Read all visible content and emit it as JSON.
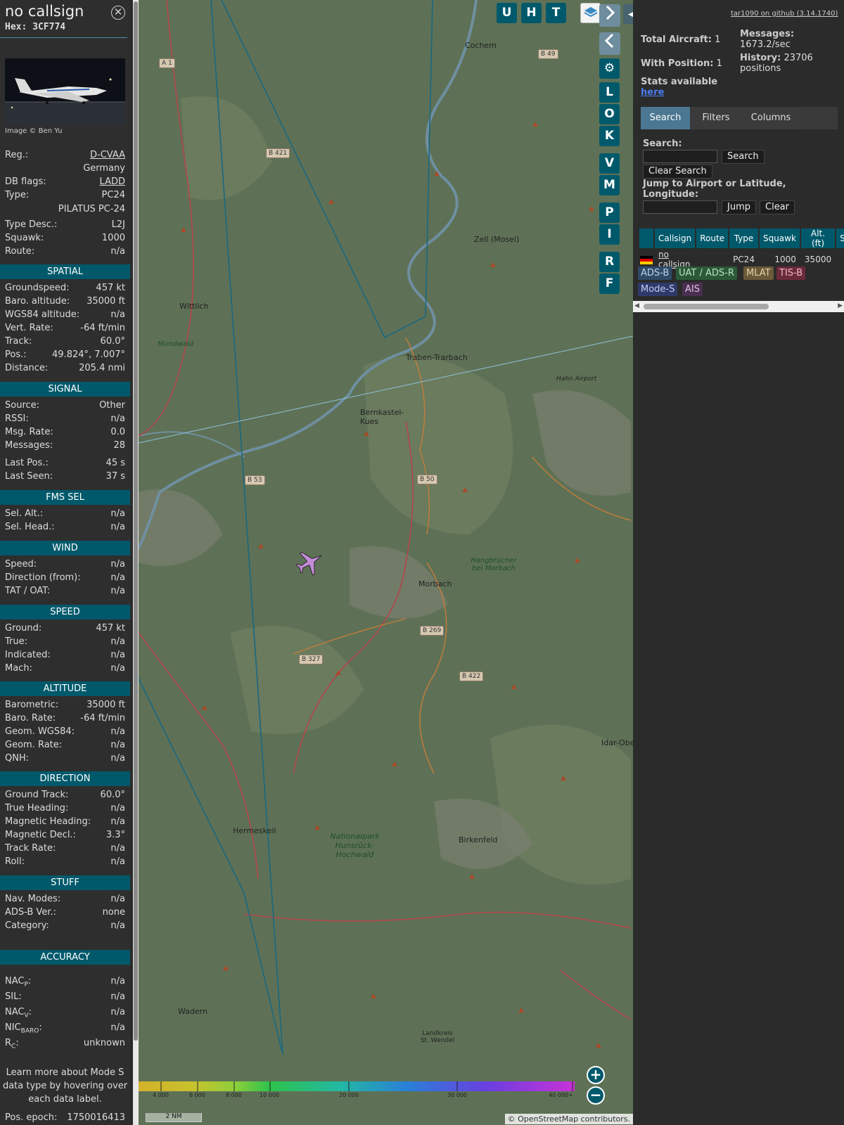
{
  "info": {
    "callsign": "no callsign",
    "hex": "Hex: 3CF774",
    "image_credit": "Image © Ben Yu",
    "reg": {
      "label": "Reg.:",
      "value": "D-CVAA",
      "country": "Germany"
    },
    "dbflags": {
      "label": "DB flags:",
      "value": "LADD"
    },
    "type": {
      "label": "Type:",
      "value": "PC24",
      "desc_full": "PILATUS PC-24"
    },
    "type_desc": {
      "label": "Type Desc.:",
      "value": "L2J"
    },
    "squawk": {
      "label": "Squawk:",
      "value": "1000"
    },
    "route": {
      "label": "Route:",
      "value": "n/a"
    },
    "sections": {
      "spatial": "SPATIAL",
      "signal": "SIGNAL",
      "fms": "FMS SEL",
      "wind": "WIND",
      "speed": "SPEED",
      "altitude": "ALTITUDE",
      "direction": "DIRECTION",
      "stuff": "STUFF",
      "accuracy": "ACCURACY"
    },
    "spatial": [
      {
        "k": "Groundspeed:",
        "v": "457 kt"
      },
      {
        "k": "Baro. altitude:",
        "v": "35000 ft"
      },
      {
        "k": "WGS84 altitude:",
        "v": "n/a"
      },
      {
        "k": "Vert. Rate:",
        "v": "-64 ft/min"
      },
      {
        "k": "Track:",
        "v": "60.0°"
      },
      {
        "k": "Pos.:",
        "v": "49.824°, 7.007°"
      },
      {
        "k": "Distance:",
        "v": "205.4 nmi"
      }
    ],
    "signal": [
      {
        "k": "Source:",
        "v": "Other"
      },
      {
        "k": "RSSI:",
        "v": "n/a"
      },
      {
        "k": "Msg. Rate:",
        "v": "0.0"
      },
      {
        "k": "Messages:",
        "v": "28"
      },
      {
        "k": "Last Pos.:",
        "v": "45 s"
      },
      {
        "k": "Last Seen:",
        "v": "37 s"
      }
    ],
    "fms": [
      {
        "k": "Sel. Alt.:",
        "v": "n/a"
      },
      {
        "k": "Sel. Head.:",
        "v": "n/a"
      }
    ],
    "wind": [
      {
        "k": "Speed:",
        "v": "n/a"
      },
      {
        "k": "Direction (from):",
        "v": "n/a"
      },
      {
        "k": "TAT / OAT:",
        "v": "n/a"
      }
    ],
    "speed": [
      {
        "k": "Ground:",
        "v": "457 kt"
      },
      {
        "k": "True:",
        "v": "n/a"
      },
      {
        "k": "Indicated:",
        "v": "n/a"
      },
      {
        "k": "Mach:",
        "v": "n/a"
      }
    ],
    "altitude": [
      {
        "k": "Barometric:",
        "v": "35000 ft"
      },
      {
        "k": "Baro. Rate:",
        "v": "-64 ft/min"
      },
      {
        "k": "Geom. WGS84:",
        "v": "n/a"
      },
      {
        "k": "Geom. Rate:",
        "v": "n/a"
      },
      {
        "k": "QNH:",
        "v": "n/a"
      }
    ],
    "direction": [
      {
        "k": "Ground Track:",
        "v": "60.0°"
      },
      {
        "k": "True Heading:",
        "v": "n/a"
      },
      {
        "k": "Magnetic Heading:",
        "v": "n/a"
      },
      {
        "k": "Magnetic Decl.:",
        "v": "3.3°"
      },
      {
        "k": "Track Rate:",
        "v": "n/a"
      },
      {
        "k": "Roll:",
        "v": "n/a"
      }
    ],
    "stuff": [
      {
        "k": "Nav. Modes:",
        "v": "n/a"
      },
      {
        "k": "ADS-B Ver.:",
        "v": "none"
      },
      {
        "k": "Category:",
        "v": "n/a"
      }
    ],
    "accuracy": [
      {
        "k": "NACp:",
        "k_base": "NAC",
        "k_sub": "P",
        "v": "n/a"
      },
      {
        "k": "SIL:",
        "v": "n/a"
      },
      {
        "k": "NACv:",
        "k_base": "NAC",
        "k_sub": "V",
        "v": "n/a"
      },
      {
        "k": "NICbaro:",
        "k_base": "NIC",
        "k_sub": "BARO",
        "v": "n/a"
      },
      {
        "k": "Rc:",
        "k_base": "R",
        "k_sub": "C",
        "v": "unknown"
      }
    ],
    "learn_more": "Learn more about Mode S data type by hovering over each data label.",
    "pos_epoch": {
      "label": "Pos. epoch:",
      "value": "1750016413"
    }
  },
  "map": {
    "top_buttons": [
      "U",
      "H",
      "T"
    ],
    "side_buttons": [
      "L",
      "O",
      "K",
      "V",
      "M",
      "P",
      "I",
      "R",
      "F"
    ],
    "places": [
      "Cochem",
      "Zell (Mosel)",
      "Wittlich",
      "Traben-Trarbach",
      "Hahn Airport",
      "Bernkastel-Kues",
      "Morbach",
      "Hangbrücher bei Morbach",
      "Idar-Obe",
      "Hermeskeil",
      "Nationalpark Hunsrück-Hochwald",
      "Birkenfeld",
      "Wadern",
      "Landkreis St. Wendel",
      "Mundwald"
    ],
    "roads": [
      "B 49",
      "A 1",
      "B 421",
      "B 53",
      "B 50",
      "B 269",
      "B 327",
      "B 422"
    ],
    "altitude_scale": [
      "4 000",
      "6 000",
      "8 000",
      "10 000",
      "20 000",
      "30 000",
      "40 000+"
    ],
    "scale_label": "2 NM",
    "attribution": "© OpenStreetMap contributors.",
    "zoom_in": "+",
    "zoom_out": "−"
  },
  "sidebar": {
    "github": "tar1090 on github (3.14.1740)",
    "total_aircraft": {
      "label": "Total Aircraft:",
      "value": "1"
    },
    "with_position": {
      "label": "With Position:",
      "value": "1"
    },
    "messages": {
      "label": "Messages:",
      "value": "1673.2/sec"
    },
    "history": {
      "label": "History:",
      "value": "23706 positions"
    },
    "stats": {
      "label": "Stats available",
      "link": "here"
    },
    "tabs": [
      "Search",
      "Filters",
      "Columns"
    ],
    "search_label": "Search:",
    "search_btn": "Search",
    "clear_search_btn": "Clear Search",
    "jump_label": "Jump to Airport or Latitude, Longitude:",
    "jump_btn": "Jump",
    "clear_btn": "Clear",
    "table": {
      "headers": [
        "",
        "Callsign",
        "Route",
        "Type",
        "Squawk",
        "Alt. (ft)",
        "S"
      ],
      "rows": [
        {
          "callsign": "no callsign",
          "route": "",
          "type": "PC24",
          "squawk": "1000",
          "alt": "35000"
        }
      ]
    },
    "sources": [
      "ADS-B",
      "UAT / ADS-R",
      "MLAT",
      "TIS-B",
      "Mode-S",
      "AIS"
    ],
    "colors": {
      "accent": "#00596b",
      "tab_active": "#4c7792"
    }
  }
}
